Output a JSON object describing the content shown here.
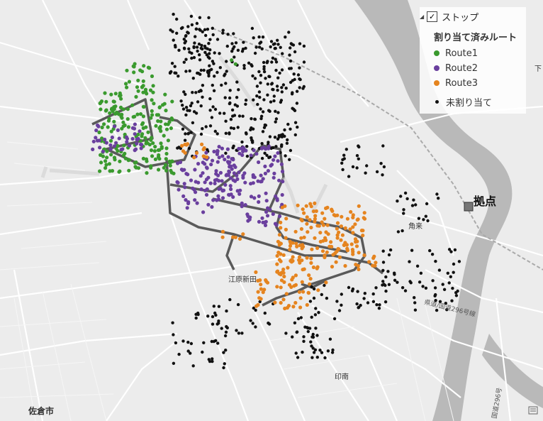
{
  "legend": {
    "layer_title": "ストップ",
    "layer_checked": "✓",
    "group_title": "割り当て済みルート",
    "items": [
      {
        "label": "Route1",
        "color": "#3a9a2e"
      },
      {
        "label": "Route2",
        "color": "#6a3f9e"
      },
      {
        "label": "Route3",
        "color": "#e5841f"
      },
      {
        "label": "未割り当て",
        "color": "#111111"
      }
    ]
  },
  "depot": {
    "label": "拠点",
    "color": "#777777"
  },
  "place_labels": {
    "sakura": "佐倉市",
    "kadoma": "角来",
    "enami": "江原新田",
    "inba": "印南",
    "edge": "下"
  },
  "road_labels": {
    "r1": "県道/国道296号線",
    "r2": "国道296号"
  },
  "colors": {
    "background": "#ececec",
    "river": "#b9b9b9",
    "route_line": "#555555"
  },
  "icons": {
    "corner": "layers-icon"
  }
}
